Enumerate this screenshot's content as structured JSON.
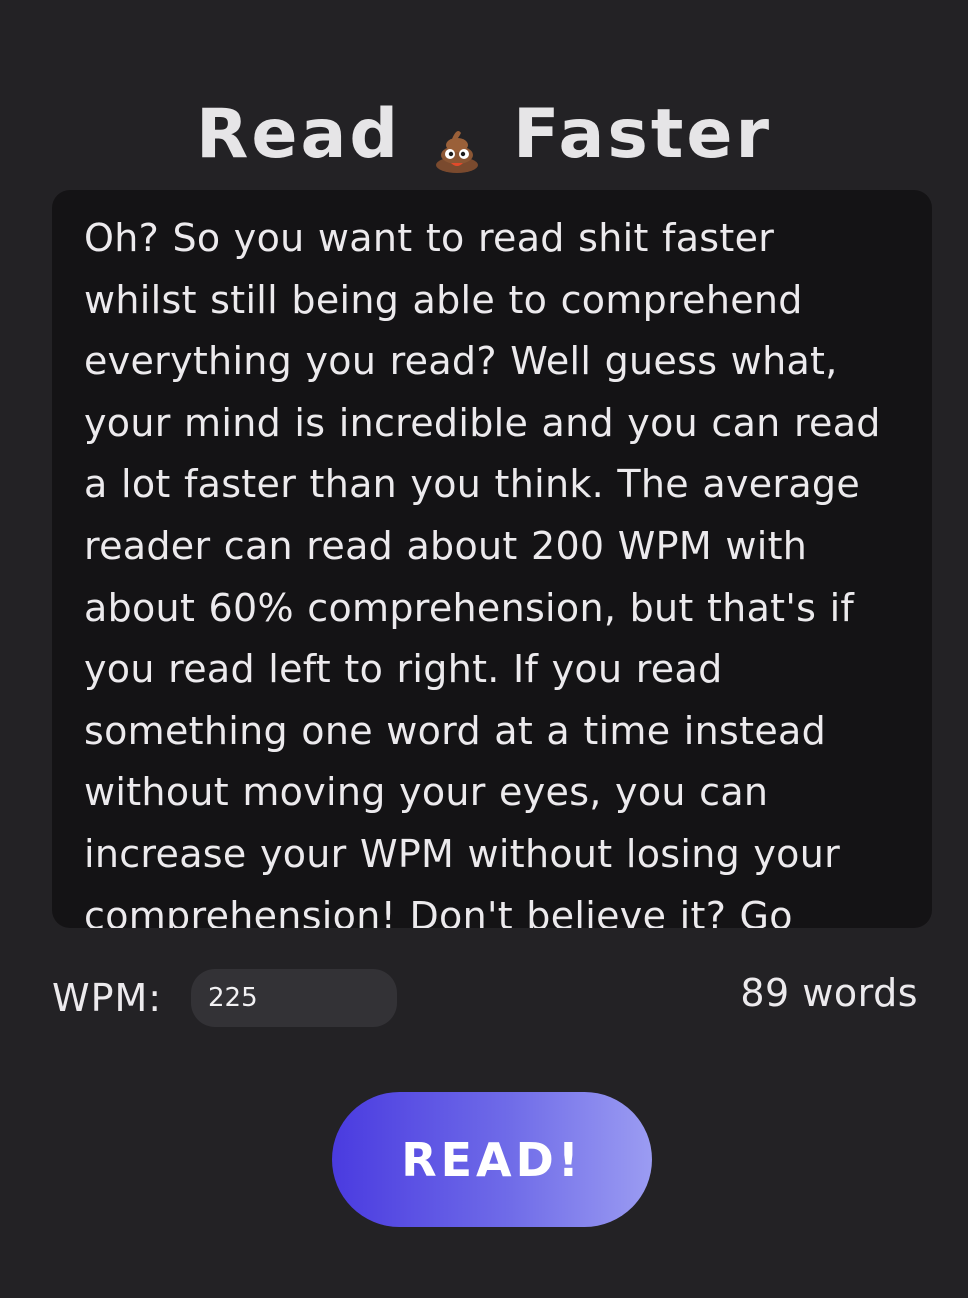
{
  "header": {
    "title_left": "Read",
    "title_icon": "poop-emoji-icon",
    "title_right": "Faster"
  },
  "reader": {
    "text": "Oh? So you want to read shit faster whilst still being able to comprehend everything you read? Well guess what, your mind is incredible and you can read a lot faster than you think. The average reader can read about 200 WPM with about 60% comprehension, but that's if you read left to right. If you read something one word at a time instead without moving your eyes, you can increase your WPM without losing your comprehension! Don't believe it? Go"
  },
  "controls": {
    "wpm_label": "WPM:",
    "wpm_value": "225",
    "word_count": "89 words",
    "read_label": "READ!"
  },
  "colors": {
    "background": "#232225",
    "text_box": "#141315",
    "input": "#333236",
    "button_gradient_start": "#4a3be0",
    "button_gradient_end": "#9b9cf2"
  }
}
